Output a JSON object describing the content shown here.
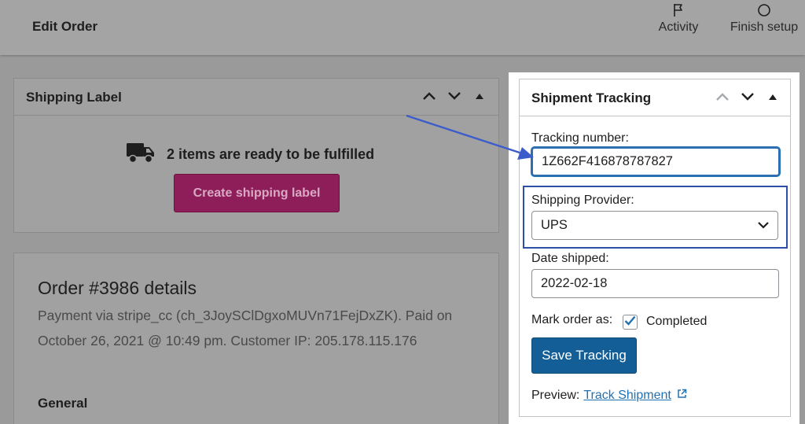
{
  "header": {
    "title": "Edit Order",
    "activity_label": "Activity",
    "finish_label": "Finish setup"
  },
  "shipping_label": {
    "title": "Shipping Label",
    "ready_text": "2 items are ready to be fulfilled",
    "create_button": "Create shipping label"
  },
  "order": {
    "title": "Order #3986 details",
    "payment_text": "Payment via stripe_cc (ch_3JoySClDgxoMUVn71FejDxZK). Paid on October 26, 2021 @ 10:49 pm. Customer IP: 205.178.115.176",
    "general_heading": "General"
  },
  "tracking": {
    "title": "Shipment Tracking",
    "tracking_number_label": "Tracking number:",
    "tracking_number_value": "1Z662F416878787827",
    "provider_label": "Shipping Provider:",
    "provider_value": "UPS",
    "date_label": "Date shipped:",
    "date_value": "2022-02-18",
    "mark_order_label": "Mark order as:",
    "completed_label": "Completed",
    "completed_checked": true,
    "save_button": "Save Tracking",
    "preview_label": "Preview:",
    "preview_link": "Track Shipment"
  },
  "colors": {
    "accent_blue": "#135e96",
    "link_blue": "#2271b1",
    "highlight_border": "#2d4fa8",
    "create_button": "#8e1e5a"
  },
  "icons": [
    "flag-icon",
    "circle-icon",
    "truck-icon",
    "chevron-up-icon",
    "chevron-down-icon",
    "triangle-up-icon",
    "external-link-icon",
    "checkmark-icon"
  ]
}
